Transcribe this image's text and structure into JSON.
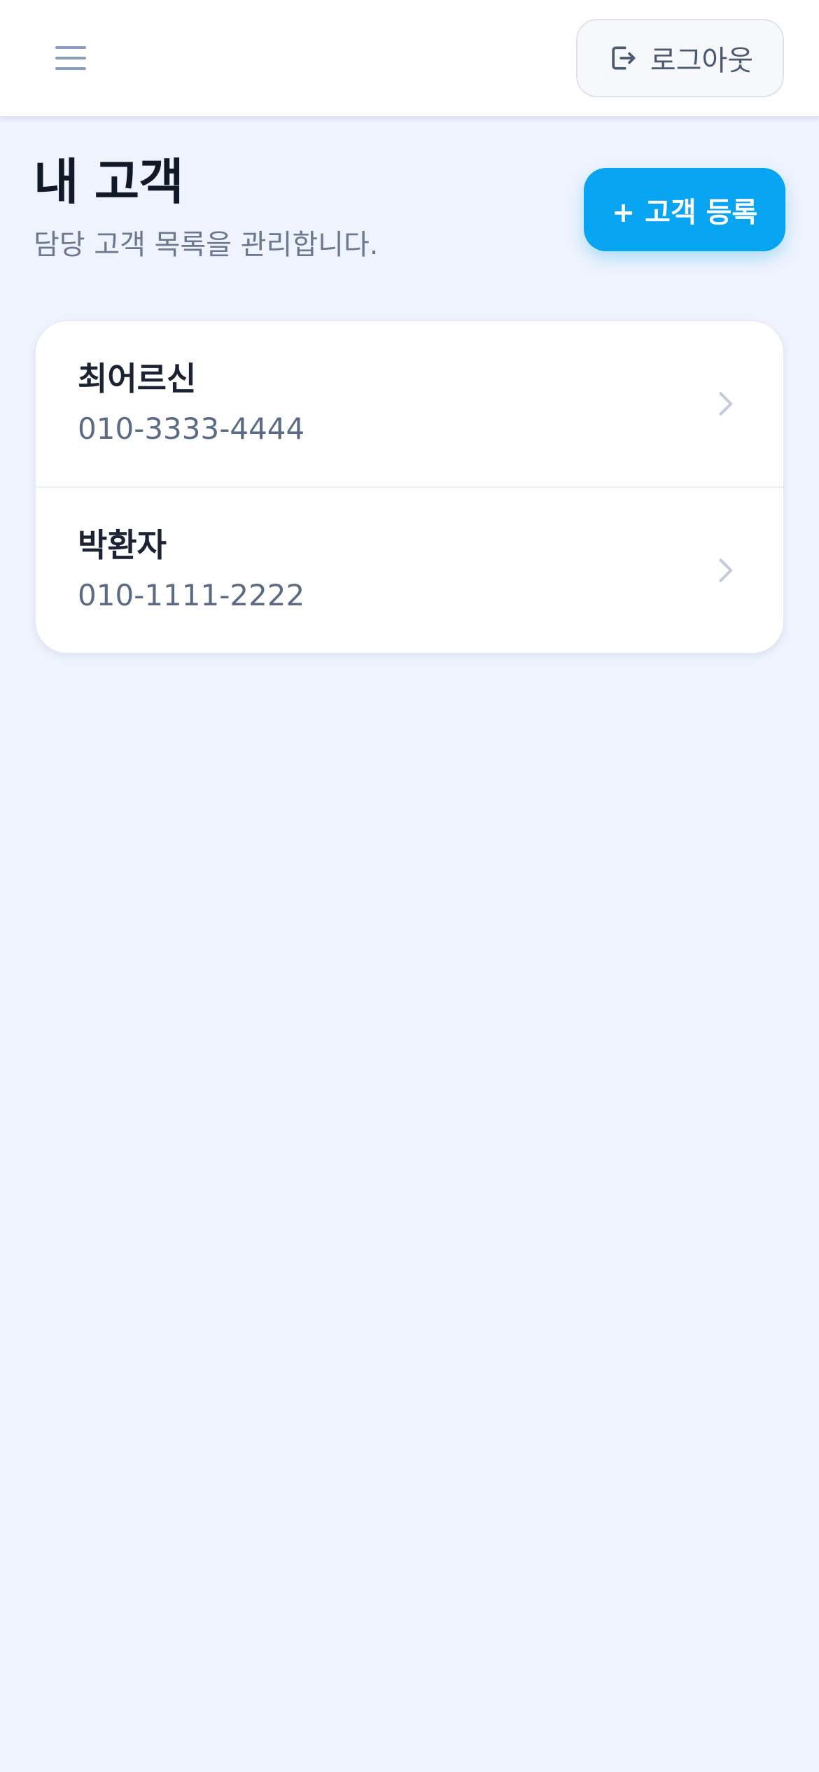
{
  "header": {
    "menu_icon": "hamburger-menu-icon",
    "logout_icon": "logout-icon",
    "logout_label": "로그아웃"
  },
  "page": {
    "title": "내 고객",
    "subtitle": "담당 고객 목록을 관리합니다.",
    "add_customer_label": "+ 고객 등록"
  },
  "customers": [
    {
      "name": "최어르신",
      "phone": "010-3333-4444"
    },
    {
      "name": "박환자",
      "phone": "010-1111-2222"
    }
  ],
  "colors": {
    "accent": "#06a4f1",
    "background": "#eef3fd",
    "title_text": "#111827",
    "muted_text": "#6b7890"
  }
}
